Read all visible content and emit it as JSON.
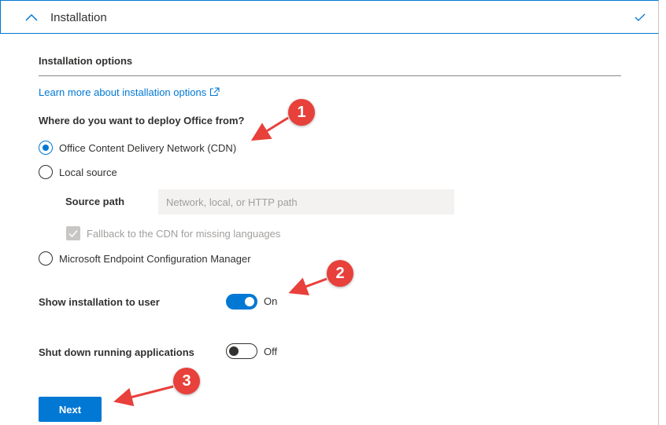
{
  "section": {
    "title": "Installation",
    "collapse_icon": "chevron-up-icon",
    "status_icon": "checkmark-icon"
  },
  "options": {
    "title": "Installation options",
    "learn_more_link": "Learn more about installation options",
    "learn_more_icon": "external-link-icon"
  },
  "deploy": {
    "question": "Where do you want to deploy Office from?",
    "radios": [
      {
        "label": "Office Content Delivery Network (CDN)",
        "checked": true
      },
      {
        "label": "Local source",
        "checked": false
      },
      {
        "label": "Microsoft Endpoint Configuration Manager",
        "checked": false
      }
    ],
    "source_path": {
      "label": "Source path",
      "placeholder": "Network, local, or HTTP path",
      "value": ""
    },
    "fallback": {
      "label": "Fallback to the CDN for missing languages",
      "checked": true,
      "disabled": true
    }
  },
  "settings": {
    "show_installation": {
      "label": "Show installation to user",
      "state": "On",
      "on": true
    },
    "shut_down_apps": {
      "label": "Shut down running applications",
      "state": "Off",
      "on": false
    }
  },
  "next_button": {
    "label": "Next"
  },
  "annotations": {
    "badges": [
      "1",
      "2",
      "3"
    ],
    "color": "#e8403b"
  },
  "colors": {
    "accent": "#0078d4",
    "text": "#323130",
    "disabled_text": "#a19f9d"
  }
}
